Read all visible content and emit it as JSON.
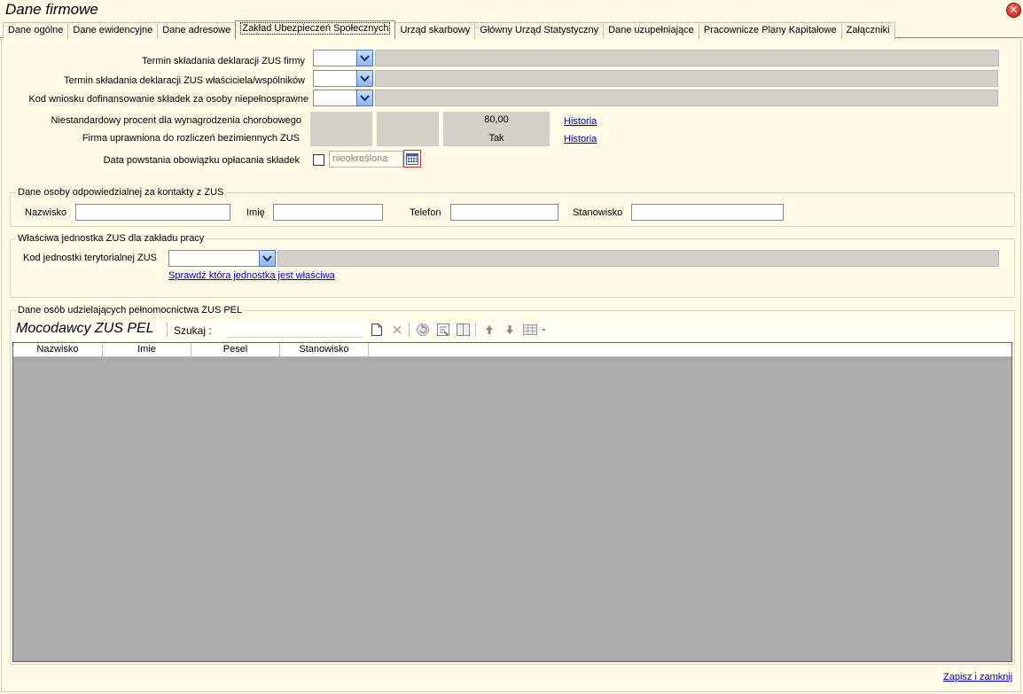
{
  "window": {
    "title": "Dane firmowe"
  },
  "tabs": [
    {
      "label": "Dane ogólne"
    },
    {
      "label": "Dane ewidencyjne"
    },
    {
      "label": "Dane adresowe"
    },
    {
      "label": "Zakład Ubezpieczeń Społecznych",
      "active": true
    },
    {
      "label": "Urząd skarbowy"
    },
    {
      "label": "Główny Urząd Statystyczny"
    },
    {
      "label": "Dane uzupełniające"
    },
    {
      "label": "Pracownicze Plany Kapitałowe"
    },
    {
      "label": "Załączniki"
    }
  ],
  "zus": {
    "termin_firmy_label": "Termin składania deklaracji ZUS firmy",
    "termin_wlasc_label": "Termin składania deklaracji ZUS  właściciela/wspólników",
    "kod_wniosku_label": "Kod wniosku dofinansowanie składek za osoby niepełnosprawne",
    "niestandard_label": "Niestandardowy procent dla wynagrodzenia chorobowego",
    "niestandard_value": "80,00",
    "firma_upr_label": "Firma uprawniona do rozliczeń bezimiennych ZUS",
    "firma_upr_value": "Tak",
    "historia1": "Historia",
    "historia2": "Historia",
    "data_powstania_label": "Data powstania obowiązku opłacania składek",
    "data_powstania_value": "nieokreślona"
  },
  "contact": {
    "group_title": "Dane osoby odpowiedzialnej za kontakty z ZUS",
    "nazwisko_label": "Nazwisko",
    "imie_label": "Imię",
    "telefon_label": "Telefon",
    "stanowisko_label": "Stanowisko"
  },
  "unit": {
    "group_title": "Właściwa jednostka ZUS dla zakładu pracy",
    "kod_label": "Kod jednostki terytorialnej ZUS",
    "check_link": "Sprawdź która jednostka jest właściwa"
  },
  "pel": {
    "group_title": "Dane osób udzielających pełnomocnictwa ZUS PEL",
    "grid_title": "Mocodawcy ZUS PEL",
    "search_label": "Szukaj  :",
    "search_value": "",
    "columns": [
      "Nazwisko",
      "Imie",
      "Pesel",
      "Stanowisko"
    ],
    "rows": []
  },
  "footer": {
    "save_close": "Zapisz i zamknij"
  }
}
